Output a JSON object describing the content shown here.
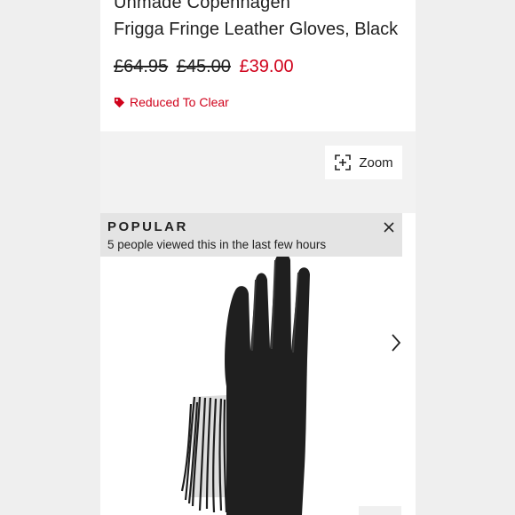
{
  "product": {
    "brand": "Unmade Copenhagen",
    "name": "Frigga Fringe Leather Gloves, Black",
    "prices": {
      "original": "£64.95",
      "was": "£45.00",
      "now": "£39.00"
    },
    "badge": "Reduced To Clear"
  },
  "gallery": {
    "zoom_label": "Zoom",
    "popular_title": "POPULAR",
    "popular_text": "5 people viewed this in the last few hours"
  },
  "colors": {
    "sale_red": "#d0021b",
    "text": "#222222",
    "popular_bg": "#e4e4e4"
  },
  "icons": {
    "badge": "tag-icon",
    "zoom": "zoom-icon",
    "close": "close-icon",
    "next": "chevron-right-icon"
  }
}
